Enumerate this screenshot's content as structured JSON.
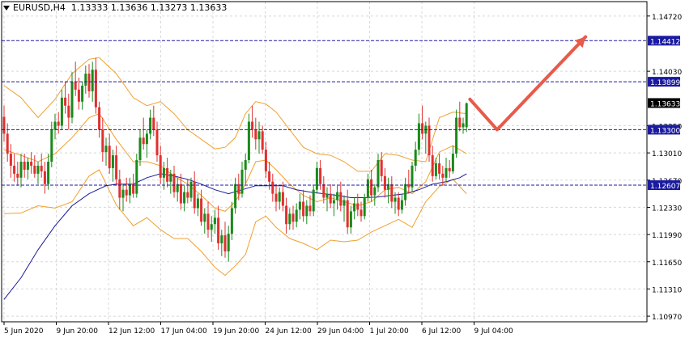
{
  "header": {
    "symbol": "EURUSD,H4",
    "ohlc": "1.13333 1.13636 1.13273 1.13633"
  },
  "colors": {
    "bull": "#1a8a1a",
    "bear": "#e03030",
    "bands": "#f0a030",
    "ma": "#1a1a9a",
    "level": "#1a1aa0",
    "arrow": "#e85a4a",
    "grid": "#d8d8d8"
  },
  "chart_data": {
    "type": "candlestick",
    "ylim": [
      1.109,
      1.149
    ],
    "y_ticks": [
      "1.14720",
      "1.14030",
      "1.13350",
      "1.13010",
      "1.12670",
      "1.12330",
      "1.11990",
      "1.11650",
      "1.11310",
      "1.10970"
    ],
    "x_ticks": [
      "5 Jun 2020",
      "9 Jun 20:00",
      "12 Jun 12:00",
      "17 Jun 04:00",
      "19 Jun 20:00",
      "24 Jun 12:00",
      "29 Jun 04:00",
      "1 Jul 20:00",
      "6 Jul 12:00",
      "9 Jul 04:00"
    ],
    "levels": [
      {
        "value": 1.14412,
        "label": "1.14412"
      },
      {
        "value": 1.13899,
        "label": "1.13899"
      },
      {
        "value": 1.133,
        "label": "1.13300"
      },
      {
        "value": 1.12607,
        "label": "1.12607"
      }
    ],
    "current_price": {
      "value": 1.13633,
      "label": "1.13633"
    },
    "arrow": [
      {
        "bar": 137,
        "price": 1.1368
      },
      {
        "bar": 145,
        "price": 1.133
      },
      {
        "bar": 171,
        "price": 1.1446
      }
    ],
    "candles": [
      [
        1.1346,
        1.136,
        1.1315,
        1.1325
      ],
      [
        1.1325,
        1.1338,
        1.129,
        1.13
      ],
      [
        1.13,
        1.1312,
        1.127,
        1.1285
      ],
      [
        1.1285,
        1.13,
        1.1265,
        1.1275
      ],
      [
        1.1275,
        1.129,
        1.126,
        1.127
      ],
      [
        1.127,
        1.13,
        1.1258,
        1.129
      ],
      [
        1.129,
        1.13,
        1.127,
        1.128
      ],
      [
        1.128,
        1.1295,
        1.1268,
        1.129
      ],
      [
        1.129,
        1.1302,
        1.1275,
        1.1285
      ],
      [
        1.1285,
        1.1298,
        1.127,
        1.1275
      ],
      [
        1.1275,
        1.129,
        1.1262,
        1.1285
      ],
      [
        1.1285,
        1.13,
        1.127,
        1.1278
      ],
      [
        1.1278,
        1.129,
        1.125,
        1.1262
      ],
      [
        1.1262,
        1.13,
        1.1255,
        1.129
      ],
      [
        1.129,
        1.134,
        1.1283,
        1.133
      ],
      [
        1.133,
        1.135,
        1.1318,
        1.134
      ],
      [
        1.134,
        1.1352,
        1.1325,
        1.1335
      ],
      [
        1.1335,
        1.138,
        1.133,
        1.137
      ],
      [
        1.137,
        1.139,
        1.135,
        1.136
      ],
      [
        1.136,
        1.1375,
        1.133,
        1.1345
      ],
      [
        1.1345,
        1.1402,
        1.1338,
        1.139
      ],
      [
        1.139,
        1.1415,
        1.1372,
        1.138
      ],
      [
        1.138,
        1.1395,
        1.1355,
        1.1365
      ],
      [
        1.1365,
        1.139,
        1.1355,
        1.1385
      ],
      [
        1.1385,
        1.141,
        1.1375,
        1.14
      ],
      [
        1.14,
        1.1412,
        1.137,
        1.1378
      ],
      [
        1.1378,
        1.1415,
        1.1365,
        1.1405
      ],
      [
        1.1405,
        1.142,
        1.135,
        1.1358
      ],
      [
        1.1358,
        1.1365,
        1.132,
        1.133
      ],
      [
        1.133,
        1.1345,
        1.129,
        1.1302
      ],
      [
        1.1302,
        1.132,
        1.1285,
        1.131
      ],
      [
        1.131,
        1.1325,
        1.1275,
        1.1282
      ],
      [
        1.1282,
        1.1305,
        1.1265,
        1.1298
      ],
      [
        1.1298,
        1.131,
        1.126,
        1.1268
      ],
      [
        1.1268,
        1.128,
        1.123,
        1.1245
      ],
      [
        1.1245,
        1.1262,
        1.1228,
        1.1255
      ],
      [
        1.1255,
        1.127,
        1.124,
        1.1248
      ],
      [
        1.1248,
        1.127,
        1.1238,
        1.1262
      ],
      [
        1.1262,
        1.1275,
        1.1245,
        1.125
      ],
      [
        1.125,
        1.13,
        1.1245,
        1.1292
      ],
      [
        1.1292,
        1.133,
        1.1285,
        1.132
      ],
      [
        1.132,
        1.1345,
        1.1305,
        1.1312
      ],
      [
        1.1312,
        1.133,
        1.1295,
        1.1325
      ],
      [
        1.1325,
        1.1355,
        1.1318,
        1.1345
      ],
      [
        1.1345,
        1.136,
        1.1322,
        1.133
      ],
      [
        1.133,
        1.134,
        1.129,
        1.1298
      ],
      [
        1.1298,
        1.131,
        1.1262,
        1.127
      ],
      [
        1.127,
        1.129,
        1.1255,
        1.1282
      ],
      [
        1.1282,
        1.1295,
        1.1258,
        1.1265
      ],
      [
        1.1265,
        1.128,
        1.125,
        1.1275
      ],
      [
        1.1275,
        1.1285,
        1.1245,
        1.1252
      ],
      [
        1.1252,
        1.127,
        1.124,
        1.1262
      ],
      [
        1.1262,
        1.1275,
        1.123,
        1.1238
      ],
      [
        1.1238,
        1.126,
        1.1228,
        1.1252
      ],
      [
        1.1252,
        1.1268,
        1.1238,
        1.1245
      ],
      [
        1.1245,
        1.127,
        1.124,
        1.1265
      ],
      [
        1.1265,
        1.1278,
        1.1225,
        1.1232
      ],
      [
        1.1232,
        1.125,
        1.1222,
        1.1244
      ],
      [
        1.1244,
        1.1255,
        1.121,
        1.1215
      ],
      [
        1.1215,
        1.1232,
        1.12,
        1.1225
      ],
      [
        1.1225,
        1.124,
        1.1195,
        1.1205
      ],
      [
        1.1205,
        1.1222,
        1.119,
        1.1212
      ],
      [
        1.1212,
        1.123,
        1.12,
        1.122
      ],
      [
        1.122,
        1.1235,
        1.118,
        1.1188
      ],
      [
        1.1188,
        1.1205,
        1.1172,
        1.1198
      ],
      [
        1.1198,
        1.1215,
        1.117,
        1.1178
      ],
      [
        1.1178,
        1.121,
        1.1165,
        1.12
      ],
      [
        1.12,
        1.124,
        1.1192,
        1.1232
      ],
      [
        1.1232,
        1.127,
        1.1225,
        1.1262
      ],
      [
        1.1262,
        1.1275,
        1.1242,
        1.125
      ],
      [
        1.125,
        1.129,
        1.1245,
        1.128
      ],
      [
        1.128,
        1.13,
        1.1262,
        1.1292
      ],
      [
        1.1292,
        1.135,
        1.1288,
        1.134
      ],
      [
        1.134,
        1.136,
        1.132,
        1.133
      ],
      [
        1.133,
        1.1345,
        1.1305,
        1.1318
      ],
      [
        1.1318,
        1.134,
        1.13,
        1.1328
      ],
      [
        1.1328,
        1.1335,
        1.13,
        1.1305
      ],
      [
        1.1305,
        1.1315,
        1.127,
        1.1278
      ],
      [
        1.1278,
        1.129,
        1.1255,
        1.1265
      ],
      [
        1.1265,
        1.1275,
        1.124,
        1.125
      ],
      [
        1.125,
        1.1262,
        1.1228,
        1.124
      ],
      [
        1.124,
        1.1258,
        1.123,
        1.1252
      ],
      [
        1.1252,
        1.1265,
        1.1228,
        1.1235
      ],
      [
        1.1235,
        1.1245,
        1.12,
        1.1212
      ],
      [
        1.1212,
        1.1232,
        1.1205,
        1.1225
      ],
      [
        1.1225,
        1.1235,
        1.1205,
        1.1215
      ],
      [
        1.1215,
        1.1238,
        1.1208,
        1.123
      ],
      [
        1.123,
        1.125,
        1.1218,
        1.124
      ],
      [
        1.124,
        1.1255,
        1.1215,
        1.1222
      ],
      [
        1.1222,
        1.1242,
        1.1212,
        1.1235
      ],
      [
        1.1235,
        1.1248,
        1.1222,
        1.1228
      ],
      [
        1.1228,
        1.126,
        1.1222,
        1.1255
      ],
      [
        1.1255,
        1.129,
        1.125,
        1.1282
      ],
      [
        1.1282,
        1.1292,
        1.1255,
        1.1262
      ],
      [
        1.1262,
        1.1272,
        1.1238,
        1.1245
      ],
      [
        1.1245,
        1.1258,
        1.1228,
        1.125
      ],
      [
        1.125,
        1.1262,
        1.1232,
        1.1238
      ],
      [
        1.1238,
        1.125,
        1.1222,
        1.1242
      ],
      [
        1.1242,
        1.126,
        1.123,
        1.1252
      ],
      [
        1.1252,
        1.1265,
        1.1228,
        1.1235
      ],
      [
        1.1235,
        1.1248,
        1.1215,
        1.1242
      ],
      [
        1.1242,
        1.1255,
        1.12,
        1.1208
      ],
      [
        1.1208,
        1.1235,
        1.12,
        1.1228
      ],
      [
        1.1228,
        1.1245,
        1.1218,
        1.1238
      ],
      [
        1.1238,
        1.125,
        1.1222,
        1.123
      ],
      [
        1.123,
        1.124,
        1.1215,
        1.1222
      ],
      [
        1.1222,
        1.125,
        1.1218,
        1.1245
      ],
      [
        1.1245,
        1.1275,
        1.124,
        1.1268
      ],
      [
        1.1268,
        1.128,
        1.124,
        1.1248
      ],
      [
        1.1248,
        1.1262,
        1.1235,
        1.1258
      ],
      [
        1.1258,
        1.13,
        1.1252,
        1.1292
      ],
      [
        1.1292,
        1.1302,
        1.1265,
        1.1272
      ],
      [
        1.1272,
        1.1282,
        1.1245,
        1.1255
      ],
      [
        1.1255,
        1.127,
        1.1238,
        1.1262
      ],
      [
        1.1262,
        1.1272,
        1.1232,
        1.124
      ],
      [
        1.124,
        1.1252,
        1.1225,
        1.1245
      ],
      [
        1.1245,
        1.1252,
        1.1222,
        1.123
      ],
      [
        1.123,
        1.125,
        1.1225,
        1.1242
      ],
      [
        1.1242,
        1.127,
        1.1235,
        1.1262
      ],
      [
        1.1262,
        1.128,
        1.125,
        1.1258
      ],
      [
        1.1258,
        1.129,
        1.1252,
        1.1285
      ],
      [
        1.1285,
        1.1315,
        1.1278,
        1.1305
      ],
      [
        1.1305,
        1.135,
        1.1298,
        1.1338
      ],
      [
        1.1338,
        1.136,
        1.1318,
        1.1325
      ],
      [
        1.1325,
        1.134,
        1.13,
        1.1335
      ],
      [
        1.1335,
        1.1345,
        1.129,
        1.1298
      ],
      [
        1.1298,
        1.131,
        1.1265,
        1.1272
      ],
      [
        1.1272,
        1.1295,
        1.1268,
        1.1288
      ],
      [
        1.1288,
        1.13,
        1.1268,
        1.1275
      ],
      [
        1.1275,
        1.1285,
        1.126,
        1.127
      ],
      [
        1.127,
        1.1295,
        1.1265,
        1.1282
      ],
      [
        1.1282,
        1.1292,
        1.127,
        1.1278
      ],
      [
        1.1278,
        1.131,
        1.1275,
        1.13
      ],
      [
        1.13,
        1.1355,
        1.1295,
        1.1345
      ],
      [
        1.1345,
        1.1365,
        1.1328,
        1.1333
      ],
      [
        1.1333,
        1.1345,
        1.1325,
        1.1338
      ],
      [
        1.1333,
        1.1364,
        1.1327,
        1.1363
      ]
    ],
    "bb_upper": [
      [
        0,
        1.1385
      ],
      [
        5,
        1.137
      ],
      [
        10,
        1.1345
      ],
      [
        15,
        1.1368
      ],
      [
        20,
        1.14
      ],
      [
        25,
        1.1418
      ],
      [
        28,
        1.142
      ],
      [
        33,
        1.14
      ],
      [
        38,
        1.137
      ],
      [
        42,
        1.136
      ],
      [
        46,
        1.1365
      ],
      [
        50,
        1.135
      ],
      [
        54,
        1.133
      ],
      [
        58,
        1.1318
      ],
      [
        62,
        1.1306
      ],
      [
        65,
        1.1308
      ],
      [
        68,
        1.132
      ],
      [
        71,
        1.135
      ],
      [
        74,
        1.1365
      ],
      [
        77,
        1.1362
      ],
      [
        80,
        1.1352
      ],
      [
        84,
        1.133
      ],
      [
        88,
        1.1308
      ],
      [
        92,
        1.13
      ],
      [
        96,
        1.1298
      ],
      [
        100,
        1.129
      ],
      [
        104,
        1.1278
      ],
      [
        108,
        1.1278
      ],
      [
        112,
        1.13
      ],
      [
        116,
        1.1298
      ],
      [
        120,
        1.1292
      ],
      [
        124,
        1.129
      ],
      [
        128,
        1.1345
      ],
      [
        132,
        1.1352
      ],
      [
        136,
        1.135
      ]
    ],
    "bb_middle": [
      [
        0,
        1.1305
      ],
      [
        5,
        1.1298
      ],
      [
        10,
        1.129
      ],
      [
        15,
        1.13
      ],
      [
        20,
        1.132
      ],
      [
        25,
        1.1345
      ],
      [
        28,
        1.135
      ],
      [
        33,
        1.1318
      ],
      [
        38,
        1.129
      ],
      [
        42,
        1.129
      ],
      [
        46,
        1.1285
      ],
      [
        50,
        1.1272
      ],
      [
        54,
        1.1262
      ],
      [
        58,
        1.1248
      ],
      [
        62,
        1.1232
      ],
      [
        65,
        1.1228
      ],
      [
        68,
        1.124
      ],
      [
        71,
        1.1262
      ],
      [
        74,
        1.129
      ],
      [
        77,
        1.1292
      ],
      [
        80,
        1.128
      ],
      [
        84,
        1.1262
      ],
      [
        88,
        1.1248
      ],
      [
        92,
        1.124
      ],
      [
        96,
        1.1245
      ],
      [
        100,
        1.124
      ],
      [
        104,
        1.1235
      ],
      [
        108,
        1.124
      ],
      [
        112,
        1.1255
      ],
      [
        116,
        1.1258
      ],
      [
        120,
        1.125
      ],
      [
        124,
        1.1265
      ],
      [
        128,
        1.1302
      ],
      [
        132,
        1.131
      ],
      [
        136,
        1.13
      ]
    ],
    "bb_lower": [
      [
        0,
        1.1225
      ],
      [
        5,
        1.1226
      ],
      [
        10,
        1.1235
      ],
      [
        15,
        1.1232
      ],
      [
        20,
        1.124
      ],
      [
        25,
        1.1272
      ],
      [
        28,
        1.128
      ],
      [
        33,
        1.1236
      ],
      [
        38,
        1.121
      ],
      [
        42,
        1.122
      ],
      [
        46,
        1.1205
      ],
      [
        50,
        1.1194
      ],
      [
        54,
        1.1194
      ],
      [
        58,
        1.1178
      ],
      [
        62,
        1.1158
      ],
      [
        65,
        1.1148
      ],
      [
        68,
        1.116
      ],
      [
        71,
        1.1174
      ],
      [
        74,
        1.1215
      ],
      [
        77,
        1.1222
      ],
      [
        80,
        1.1208
      ],
      [
        84,
        1.1194
      ],
      [
        88,
        1.1188
      ],
      [
        92,
        1.118
      ],
      [
        96,
        1.1192
      ],
      [
        100,
        1.119
      ],
      [
        104,
        1.1192
      ],
      [
        108,
        1.1202
      ],
      [
        112,
        1.121
      ],
      [
        116,
        1.1218
      ],
      [
        120,
        1.1208
      ],
      [
        124,
        1.124
      ],
      [
        128,
        1.1259
      ],
      [
        132,
        1.1268
      ],
      [
        136,
        1.125
      ]
    ],
    "ma": [
      [
        0,
        1.1118
      ],
      [
        5,
        1.1145
      ],
      [
        10,
        1.118
      ],
      [
        15,
        1.121
      ],
      [
        20,
        1.1235
      ],
      [
        25,
        1.125
      ],
      [
        30,
        1.126
      ],
      [
        33,
        1.1262
      ],
      [
        38,
        1.1262
      ],
      [
        42,
        1.127
      ],
      [
        46,
        1.1275
      ],
      [
        50,
        1.1272
      ],
      [
        54,
        1.1268
      ],
      [
        58,
        1.1262
      ],
      [
        62,
        1.1255
      ],
      [
        66,
        1.125
      ],
      [
        70,
        1.1255
      ],
      [
        74,
        1.126
      ],
      [
        78,
        1.126
      ],
      [
        82,
        1.126
      ],
      [
        86,
        1.1255
      ],
      [
        90,
        1.1252
      ],
      [
        94,
        1.125
      ],
      [
        98,
        1.1248
      ],
      [
        102,
        1.1245
      ],
      [
        106,
        1.1245
      ],
      [
        110,
        1.1246
      ],
      [
        114,
        1.1248
      ],
      [
        118,
        1.125
      ],
      [
        122,
        1.1255
      ],
      [
        126,
        1.1262
      ],
      [
        130,
        1.1265
      ],
      [
        134,
        1.127
      ],
      [
        136,
        1.1275
      ]
    ]
  }
}
